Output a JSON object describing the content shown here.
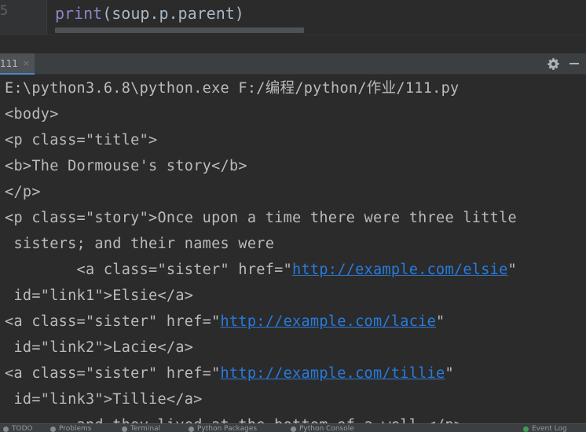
{
  "editor": {
    "line_number": "5",
    "code_builtin": "print",
    "code_rest": "(soup.p.parent)"
  },
  "run": {
    "tab_label": "111",
    "tab_close": "×",
    "icons": [
      "settings-gear-icon",
      "minimize-icon"
    ]
  },
  "console": {
    "lines": [
      {
        "text": "E:\\python3.6.8\\python.exe F:/编程/python/作业/111.py"
      },
      {
        "text": "<body>"
      },
      {
        "text": "<p class=\"title\">"
      },
      {
        "text": "<b>The Dormouse's story</b>"
      },
      {
        "text": "</p>"
      },
      {
        "text": "<p class=\"story\">Once upon a time there were three little"
      },
      {
        "text": " sisters; and their names were"
      },
      {
        "pre": "        <a class=\"sister\" href=\"",
        "link": "http://example.com/elsie",
        "post": "\""
      },
      {
        "text": " id=\"link1\">Elsie</a>"
      },
      {
        "pre": "<a class=\"sister\" href=\"",
        "link": "http://example.com/lacie",
        "post": "\""
      },
      {
        "text": " id=\"link2\">Lacie</a>"
      },
      {
        "pre": "<a class=\"sister\" href=\"",
        "link": "http://example.com/tillie",
        "post": "\""
      },
      {
        "text": " id=\"link3\">Tillie</a>"
      },
      {
        "text": "        and they lived at the bottom of a well.</p>"
      }
    ]
  },
  "statusbar": {
    "items": [
      {
        "label": "TODO",
        "icon": "todo-icon"
      },
      {
        "label": "Problems",
        "icon": "problems-icon"
      },
      {
        "label": "Terminal",
        "icon": "terminal-icon"
      },
      {
        "label": "Python Packages",
        "icon": "packages-icon"
      },
      {
        "label": "Python Console",
        "icon": "python-console-icon"
      },
      {
        "label": "Event Log",
        "icon": "event-log-icon"
      }
    ]
  }
}
